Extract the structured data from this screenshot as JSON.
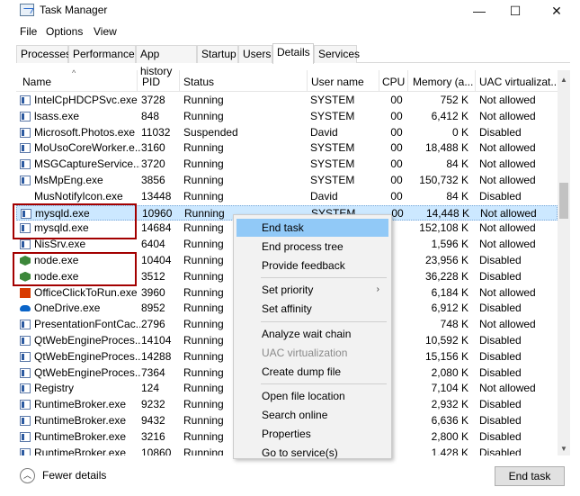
{
  "window": {
    "title": "Task Manager",
    "minimize_glyph": "—",
    "maximize_glyph": "☐",
    "close_glyph": "✕"
  },
  "menu": [
    "File",
    "Options",
    "View"
  ],
  "tabs": [
    {
      "label": "Processes"
    },
    {
      "label": "Performance"
    },
    {
      "label": "App history"
    },
    {
      "label": "Startup"
    },
    {
      "label": "Users"
    },
    {
      "label": "Details",
      "active": true
    },
    {
      "label": "Services"
    }
  ],
  "columns": {
    "name": "Name",
    "pid": "PID",
    "status": "Status",
    "user": "User name",
    "cpu": "CPU",
    "memory": "Memory (a...",
    "uac": "UAC virtualizat..."
  },
  "rows": [
    {
      "icon": "generic-app-icon",
      "name": "IntelCpHDCPSvc.exe",
      "pid": "3728",
      "status": "Running",
      "user": "SYSTEM",
      "cpu": "00",
      "memory": "752 K",
      "uac": "Not allowed"
    },
    {
      "icon": "generic-app-icon",
      "name": "lsass.exe",
      "pid": "848",
      "status": "Running",
      "user": "SYSTEM",
      "cpu": "00",
      "memory": "6,412 K",
      "uac": "Not allowed"
    },
    {
      "icon": "generic-app-icon",
      "name": "Microsoft.Photos.exe",
      "pid": "11032",
      "status": "Suspended",
      "user": "David",
      "cpu": "00",
      "memory": "0 K",
      "uac": "Disabled"
    },
    {
      "icon": "generic-app-icon",
      "name": "MoUsoCoreWorker.e...",
      "pid": "3160",
      "status": "Running",
      "user": "SYSTEM",
      "cpu": "00",
      "memory": "18,488 K",
      "uac": "Not allowed"
    },
    {
      "icon": "generic-app-icon",
      "name": "MSGCaptureService....",
      "pid": "3720",
      "status": "Running",
      "user": "SYSTEM",
      "cpu": "00",
      "memory": "84 K",
      "uac": "Not allowed"
    },
    {
      "icon": "generic-app-icon",
      "name": "MsMpEng.exe",
      "pid": "3856",
      "status": "Running",
      "user": "SYSTEM",
      "cpu": "00",
      "memory": "150,732 K",
      "uac": "Not allowed"
    },
    {
      "icon": "none",
      "name": "MusNotifyIcon.exe",
      "pid": "13448",
      "status": "Running",
      "user": "David",
      "cpu": "00",
      "memory": "84 K",
      "uac": "Disabled"
    },
    {
      "icon": "generic-app-icon",
      "name": "mysqld.exe",
      "pid": "10960",
      "status": "Running",
      "user": "SYSTEM",
      "cpu": "00",
      "memory": "14,448 K",
      "uac": "Not allowed",
      "selected": true
    },
    {
      "icon": "generic-app-icon",
      "name": "mysqld.exe",
      "pid": "14684",
      "status": "Running",
      "user": "",
      "cpu": "",
      "memory": "152,108 K",
      "uac": "Not allowed"
    },
    {
      "icon": "generic-app-icon",
      "name": "NisSrv.exe",
      "pid": "6404",
      "status": "Running",
      "user": "",
      "cpu": "",
      "memory": "1,596 K",
      "uac": "Not allowed"
    },
    {
      "icon": "node-icon",
      "name": "node.exe",
      "pid": "10404",
      "status": "Running",
      "user": "",
      "cpu": "",
      "memory": "23,956 K",
      "uac": "Disabled"
    },
    {
      "icon": "node-icon",
      "name": "node.exe",
      "pid": "3512",
      "status": "Running",
      "user": "",
      "cpu": "",
      "memory": "36,228 K",
      "uac": "Disabled"
    },
    {
      "icon": "office-icon",
      "name": "OfficeClickToRun.exe",
      "pid": "3960",
      "status": "Running",
      "user": "",
      "cpu": "",
      "memory": "6,184 K",
      "uac": "Not allowed"
    },
    {
      "icon": "onedrive-icon",
      "name": "OneDrive.exe",
      "pid": "8952",
      "status": "Running",
      "user": "",
      "cpu": "",
      "memory": "6,912 K",
      "uac": "Disabled"
    },
    {
      "icon": "generic-app-icon",
      "name": "PresentationFontCac...",
      "pid": "2796",
      "status": "Running",
      "user": "",
      "cpu": "",
      "memory": "748 K",
      "uac": "Not allowed"
    },
    {
      "icon": "generic-app-icon",
      "name": "QtWebEngineProces...",
      "pid": "14104",
      "status": "Running",
      "user": "",
      "cpu": "",
      "memory": "10,592 K",
      "uac": "Disabled"
    },
    {
      "icon": "generic-app-icon",
      "name": "QtWebEngineProces...",
      "pid": "14288",
      "status": "Running",
      "user": "",
      "cpu": "",
      "memory": "15,156 K",
      "uac": "Disabled"
    },
    {
      "icon": "generic-app-icon",
      "name": "QtWebEngineProces...",
      "pid": "7364",
      "status": "Running",
      "user": "",
      "cpu": "",
      "memory": "2,080 K",
      "uac": "Disabled"
    },
    {
      "icon": "generic-app-icon",
      "name": "Registry",
      "pid": "124",
      "status": "Running",
      "user": "",
      "cpu": "",
      "memory": "7,104 K",
      "uac": "Not allowed"
    },
    {
      "icon": "generic-app-icon",
      "name": "RuntimeBroker.exe",
      "pid": "9232",
      "status": "Running",
      "user": "",
      "cpu": "",
      "memory": "2,932 K",
      "uac": "Disabled"
    },
    {
      "icon": "generic-app-icon",
      "name": "RuntimeBroker.exe",
      "pid": "9432",
      "status": "Running",
      "user": "",
      "cpu": "",
      "memory": "6,636 K",
      "uac": "Disabled"
    },
    {
      "icon": "generic-app-icon",
      "name": "RuntimeBroker.exe",
      "pid": "3216",
      "status": "Running",
      "user": "",
      "cpu": "",
      "memory": "2,800 K",
      "uac": "Disabled"
    },
    {
      "icon": "generic-app-icon",
      "name": "RuntimeBroker.exe",
      "pid": "10860",
      "status": "Running",
      "user": "",
      "cpu": "",
      "memory": "1,428 K",
      "uac": "Disabled"
    }
  ],
  "context_menu": [
    {
      "label": "End task",
      "hover": true
    },
    {
      "label": "End process tree"
    },
    {
      "label": "Provide feedback"
    },
    {
      "separator": true
    },
    {
      "label": "Set priority",
      "submenu": true
    },
    {
      "label": "Set affinity"
    },
    {
      "separator": true
    },
    {
      "label": "Analyze wait chain"
    },
    {
      "label": "UAC virtualization",
      "disabled": true
    },
    {
      "label": "Create dump file"
    },
    {
      "separator": true
    },
    {
      "label": "Open file location"
    },
    {
      "label": "Search online"
    },
    {
      "label": "Properties"
    },
    {
      "label": "Go to service(s)"
    }
  ],
  "footer": {
    "fewer_details": "Fewer details",
    "end_task": "End task"
  },
  "colors": {
    "highlight_box": "#a30000",
    "selection": "#cce8ff",
    "menu_hover": "#91c9f7"
  }
}
